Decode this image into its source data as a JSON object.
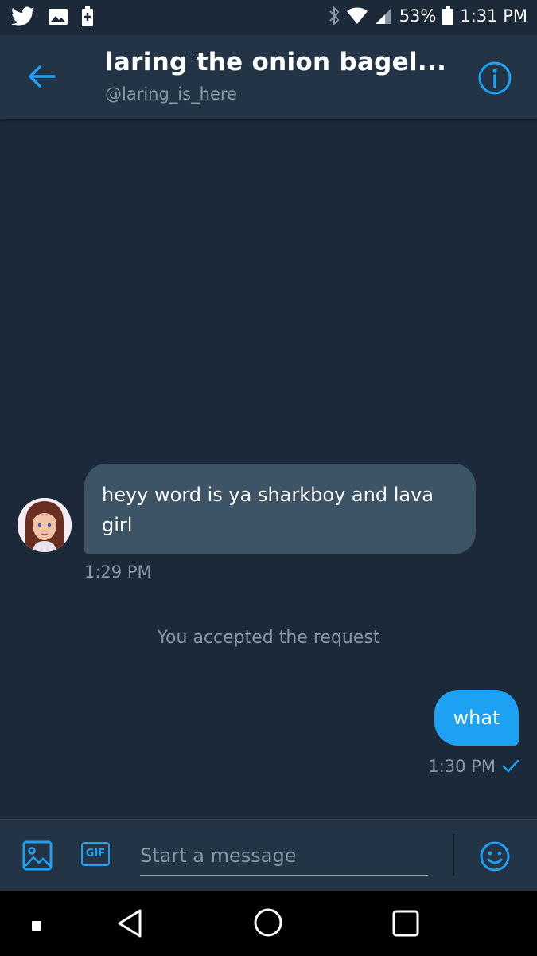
{
  "status_bar": {
    "left_icons": [
      "twitter-bird-icon",
      "image-icon",
      "battery-saver-icon"
    ],
    "right_icons": [
      "bluetooth-icon",
      "wifi-icon",
      "signal-icon",
      "battery-icon"
    ],
    "battery": "53%",
    "time": "1:31 PM"
  },
  "header": {
    "title": "laring the onion bagel...",
    "handle": "@laring_is_here",
    "back_icon": "arrow-left-icon",
    "info_icon": "info-icon"
  },
  "conversation": {
    "messages": [
      {
        "direction": "incoming",
        "text": "heyy word is ya sharkboy and lava girl",
        "time": "1:29 PM"
      },
      {
        "direction": "outgoing",
        "text": "what",
        "time": "1:30 PM",
        "status_icon": "checkmark-icon"
      }
    ],
    "system_note": "You accepted the request"
  },
  "composer": {
    "placeholder": "Start a message",
    "gif_label": "GIF",
    "image_icon": "image-icon",
    "emoji_icon": "smiley-icon"
  },
  "nav_bar": {
    "icons": [
      "square-dot-icon",
      "back-triangle-icon",
      "home-circle-icon",
      "recents-square-icon"
    ]
  },
  "colors": {
    "background": "#1c2938",
    "header": "#243447",
    "accent": "#1da1f2",
    "incoming_bubble": "#3d5366",
    "muted_text": "#8899a6"
  }
}
